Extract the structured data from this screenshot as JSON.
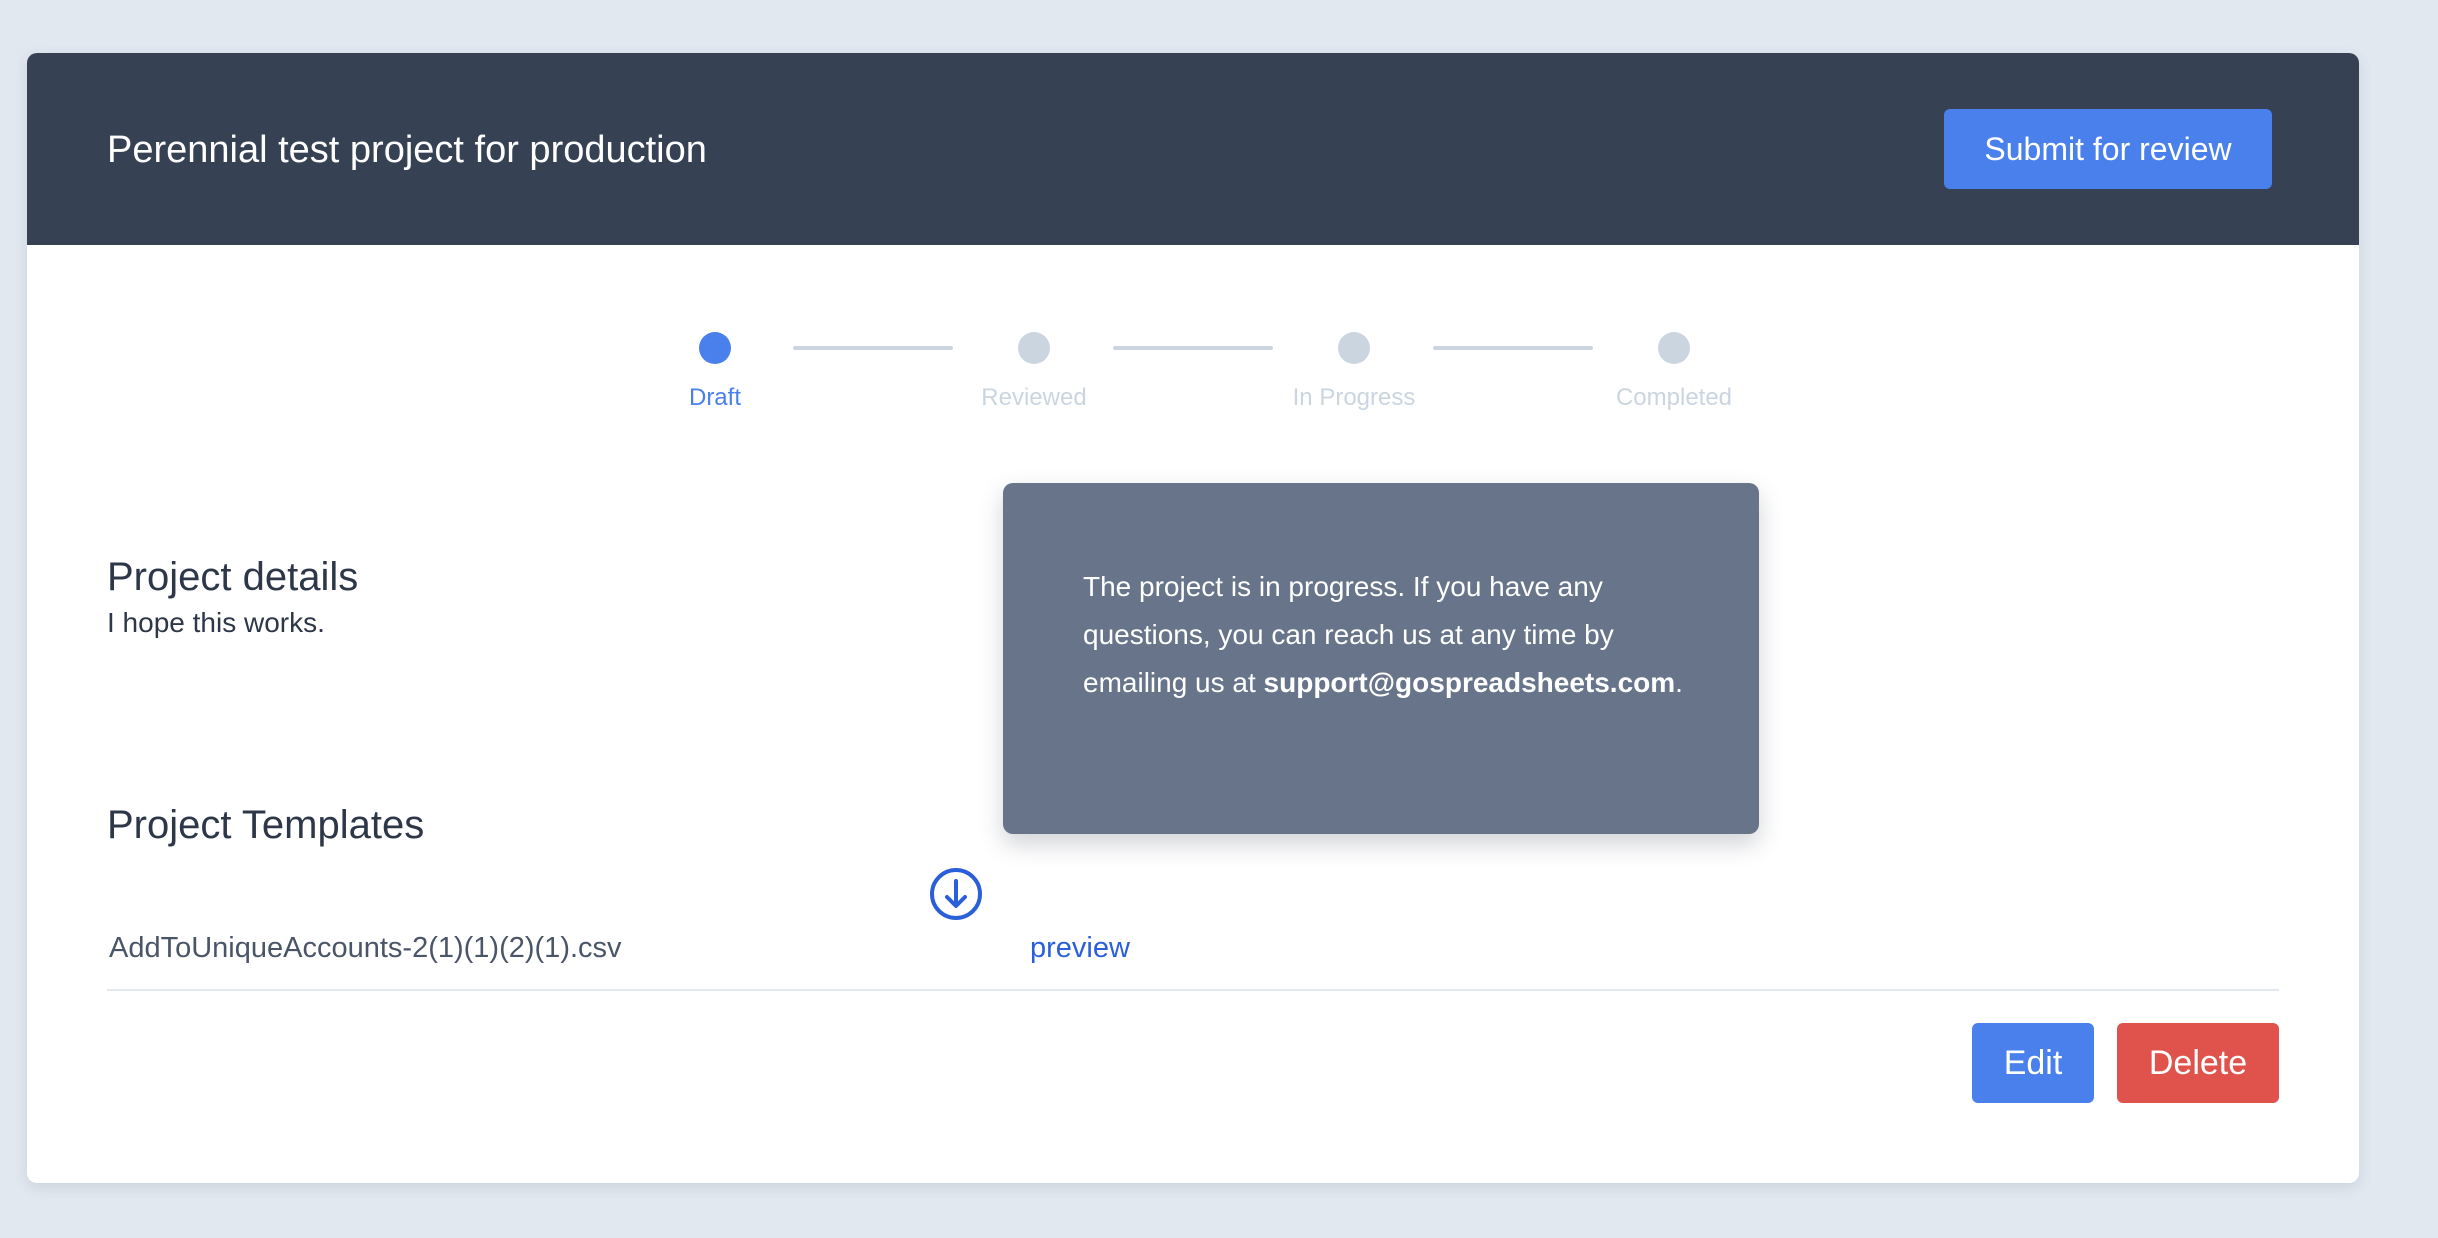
{
  "header": {
    "title": "Perennial test project for production",
    "submit_label": "Submit for review"
  },
  "stepper": {
    "steps": [
      {
        "label": "Draft",
        "active": true
      },
      {
        "label": "Reviewed",
        "active": false
      },
      {
        "label": "In Progress",
        "active": false
      },
      {
        "label": "Completed",
        "active": false
      }
    ]
  },
  "tooltip": {
    "message_before": "The project is in progress. If you have any questions, you can reach us at any time by emailing us at ",
    "email": "support@gospreadsheets.com",
    "message_after": "."
  },
  "details": {
    "title": "Project details",
    "text": "I hope this works."
  },
  "templates": {
    "title": "Project Templates",
    "items": [
      {
        "filename": "AddToUniqueAccounts-2(1)(1)(2)(1).csv",
        "download_icon": "download-circle-icon",
        "preview_label": "preview"
      }
    ]
  },
  "actions": {
    "edit_label": "Edit",
    "delete_label": "Delete"
  },
  "colors": {
    "page_bg": "#e2e8f0",
    "header_bg": "#364153",
    "accent": "#4a80ec",
    "danger": "#e0524c",
    "tooltip_bg": "#677489",
    "inactive": "#cbd5e0",
    "link": "#2b5fd9"
  }
}
